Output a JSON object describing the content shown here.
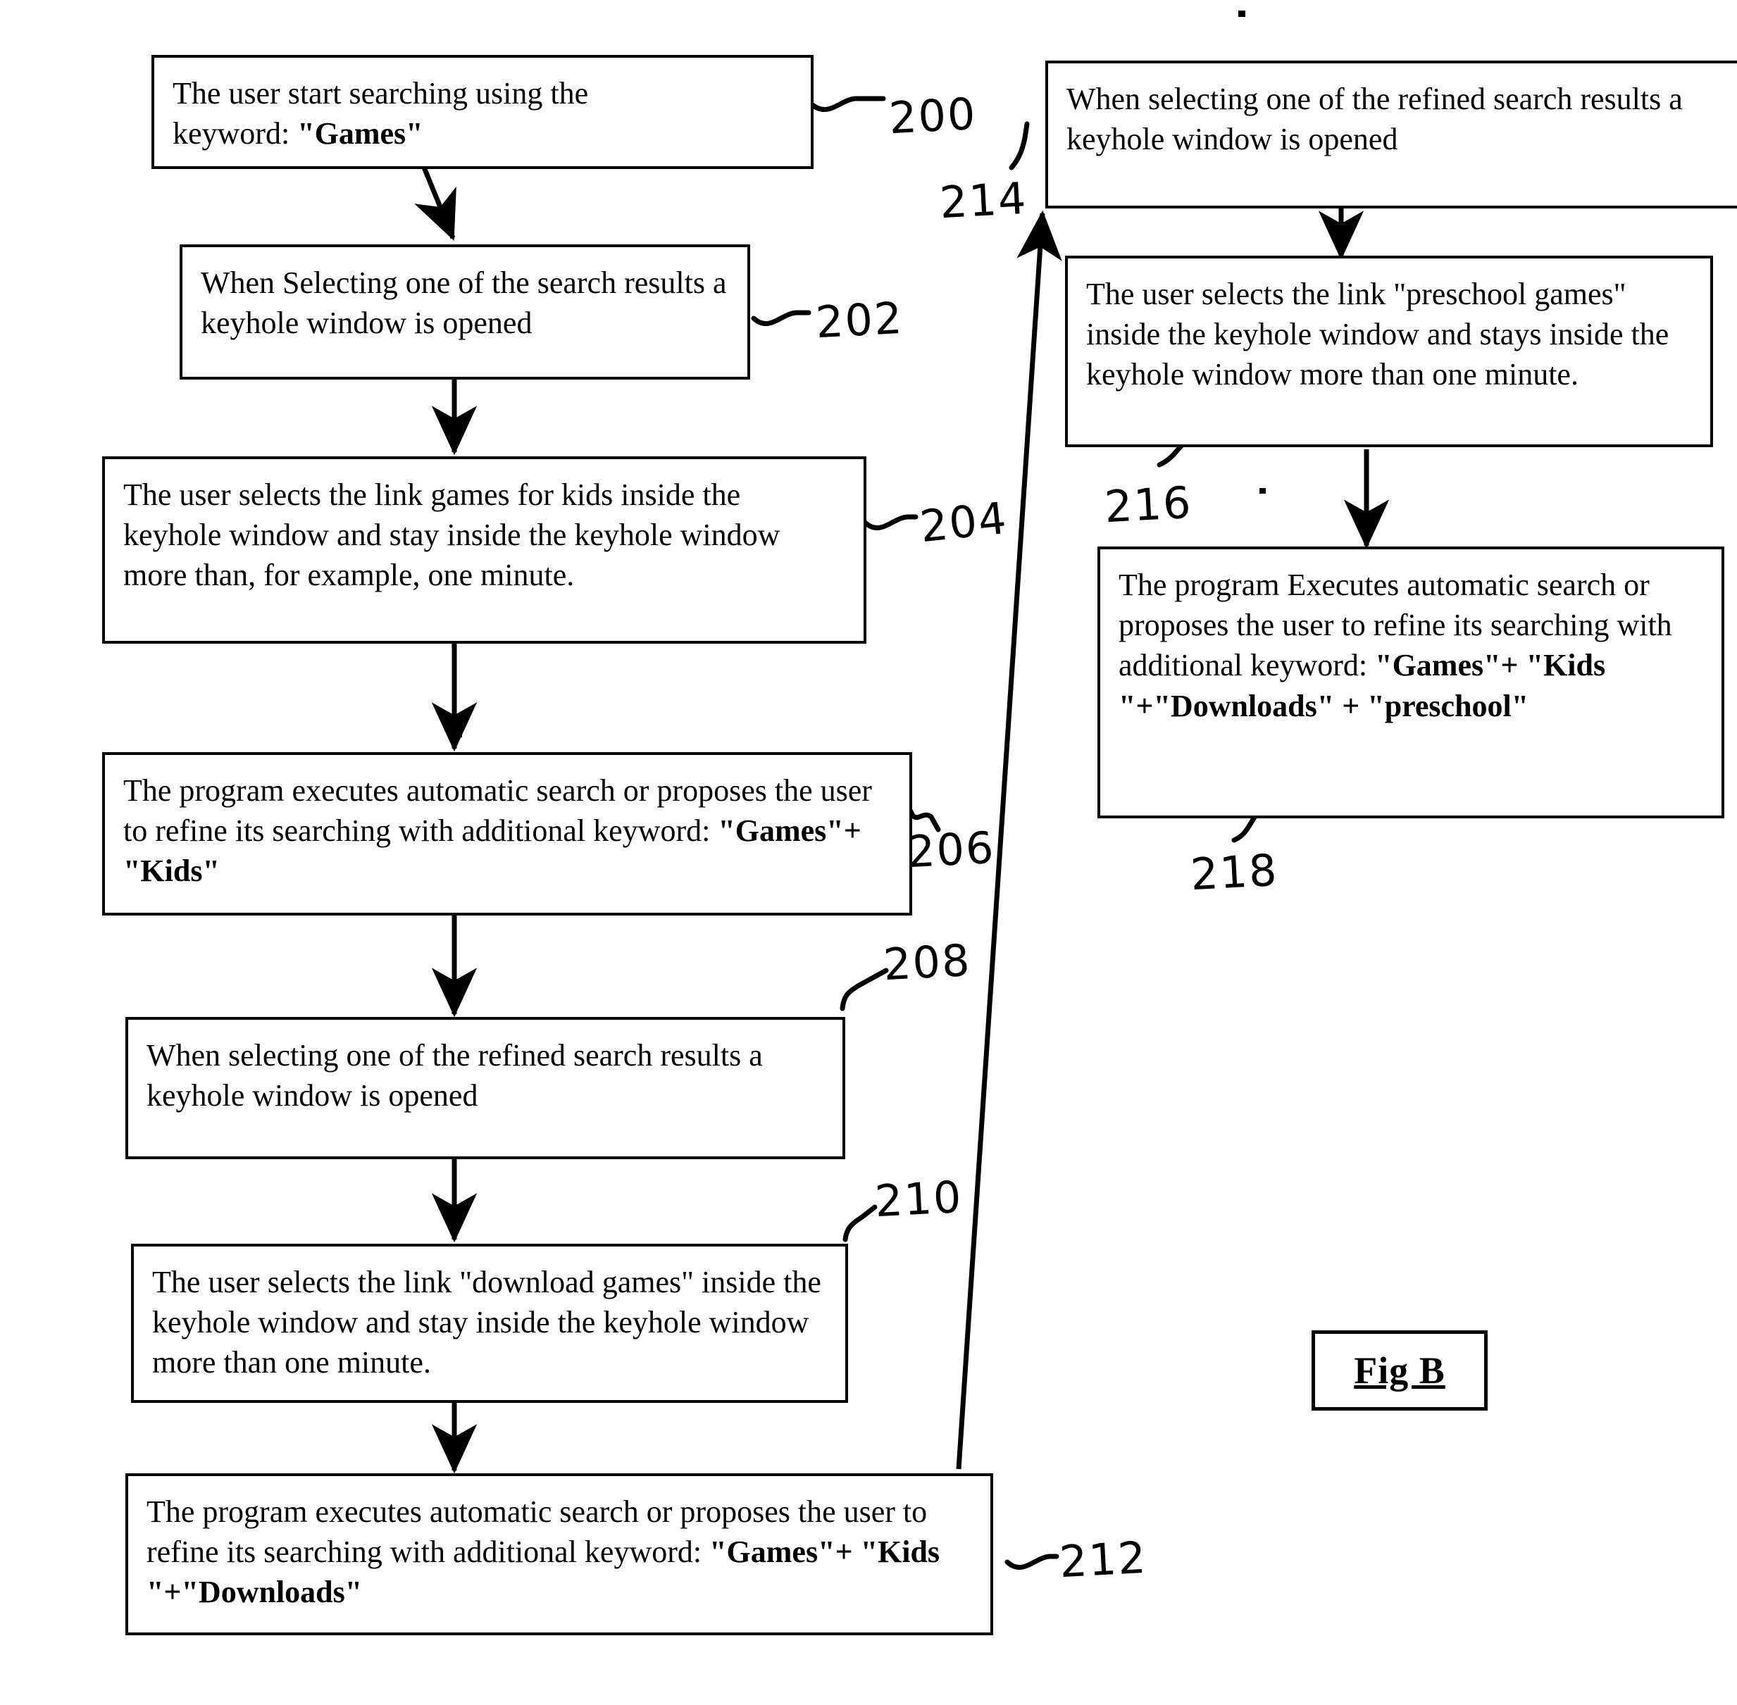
{
  "figure": {
    "caption": "Fig B"
  },
  "nodes": [
    {
      "id": "200",
      "ref": "200",
      "lines": [
        {
          "text": "The user start searching using the "
        },
        {
          "text": "keyword: ",
          "bold_tail": "\"Games\""
        }
      ],
      "plain": "The user start searching using the keyword: \"Games\""
    },
    {
      "id": "202",
      "ref": "202",
      "plain": "When Selecting one of the search results a keyhole window is opened"
    },
    {
      "id": "204",
      "ref": "204",
      "plain": "The user selects the link games for kids inside the keyhole window and stay inside the keyhole window more than, for example, one minute."
    },
    {
      "id": "206",
      "ref": "206",
      "plain": "The program executes automatic search or proposes the user to refine its searching with additional  keyword: ",
      "bold": "\"Games\"+ \"Kids\""
    },
    {
      "id": "208",
      "ref": "208",
      "plain": "When selecting one of the refined search results a keyhole window is opened"
    },
    {
      "id": "210",
      "ref": "210",
      "plain": "The user selects the link \"download games\" inside the keyhole window and stay inside the keyhole window more than one minute."
    },
    {
      "id": "212",
      "ref": "212",
      "plain": "The program executes automatic search or proposes the user to refine its searching with additional  keyword: ",
      "bold": "\"Games\"+ \"Kids \"+\"Downloads\""
    },
    {
      "id": "214",
      "ref": "214",
      "plain": "When selecting one of the refined search results a keyhole window is opened"
    },
    {
      "id": "216",
      "ref": "216",
      "plain": "The user selects the link \"preschool games\" inside the keyhole window and stays inside the keyhole window more than one minute."
    },
    {
      "id": "218",
      "ref": "218",
      "plain": "The program Executes automatic search or proposes the user to refine its searching with additional  keyword: ",
      "bold": "\"Games\"+ \"Kids \"+\"Downloads\" + \"preschool\""
    }
  ],
  "node_text": {
    "n200_a": "The user start searching using the",
    "n200_b": "keyword: ",
    "n200_kw": "\"Games\"",
    "n202": "When Selecting one of the search results a keyhole window is opened",
    "n204": "The user selects the link games for kids inside the keyhole window and stay inside the keyhole window more than, for example, one minute.",
    "n206_a": "The program executes automatic search or proposes the user to refine its searching with additional  keyword: ",
    "n206_kw": "\"Games\"+ \"Kids\"",
    "n208": "When selecting one of the refined search results a keyhole window is opened",
    "n210": "The user selects the link \"download games\" inside the keyhole window and stay inside the keyhole window more than one minute.",
    "n212_a": "The program executes automatic search or proposes the user to refine its searching with additional  keyword: ",
    "n212_kw": "\"Games\"+ \"Kids \"+\"Downloads\"",
    "n214": "When selecting one of the refined search results a keyhole window is opened",
    "n216": "The user selects the link \"preschool games\" inside the keyhole window and stays inside the keyhole window more than one minute.",
    "n218_a": "The program Executes automatic search or proposes the user to refine its searching with additional  keyword: ",
    "n218_kw": "\"Games\"+ \"Kids \"+\"Downloads\" + \"preschool\""
  },
  "refs": {
    "r200": "200",
    "r202": "202",
    "r204": "204",
    "r206": "206",
    "r208": "208",
    "r210": "210",
    "r212": "212",
    "r214": "214",
    "r216": "216",
    "r218": "218"
  }
}
